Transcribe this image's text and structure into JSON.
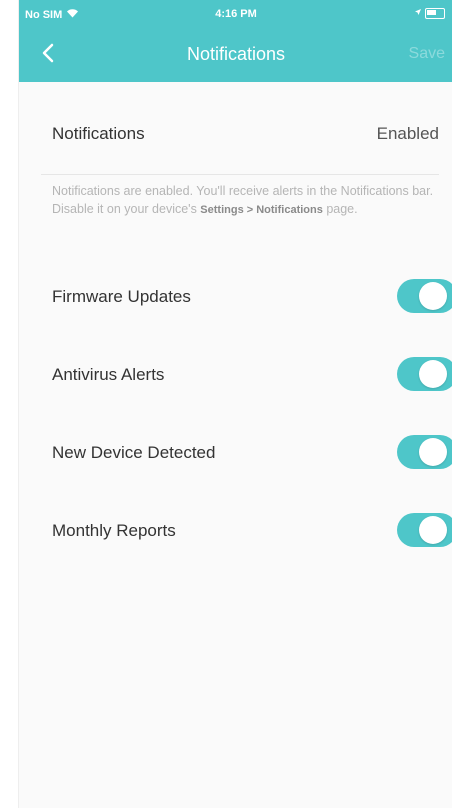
{
  "status_bar": {
    "carrier": "No SIM",
    "time": "4:16 PM"
  },
  "nav": {
    "title": "Notifications",
    "save_label": "Save"
  },
  "notifications": {
    "label": "Notifications",
    "value": "Enabled",
    "description_main": "Notifications are enabled. You'll receive alerts in the Notifications bar. Disable it on your device's ",
    "description_path": "Settings > Notifications",
    "description_end": " page."
  },
  "toggles": [
    {
      "label": "Firmware Updates",
      "enabled": true
    },
    {
      "label": "Antivirus Alerts",
      "enabled": true
    },
    {
      "label": "New Device Detected",
      "enabled": true
    },
    {
      "label": "Monthly Reports",
      "enabled": true
    }
  ],
  "colors": {
    "accent": "#4ec6c9"
  }
}
